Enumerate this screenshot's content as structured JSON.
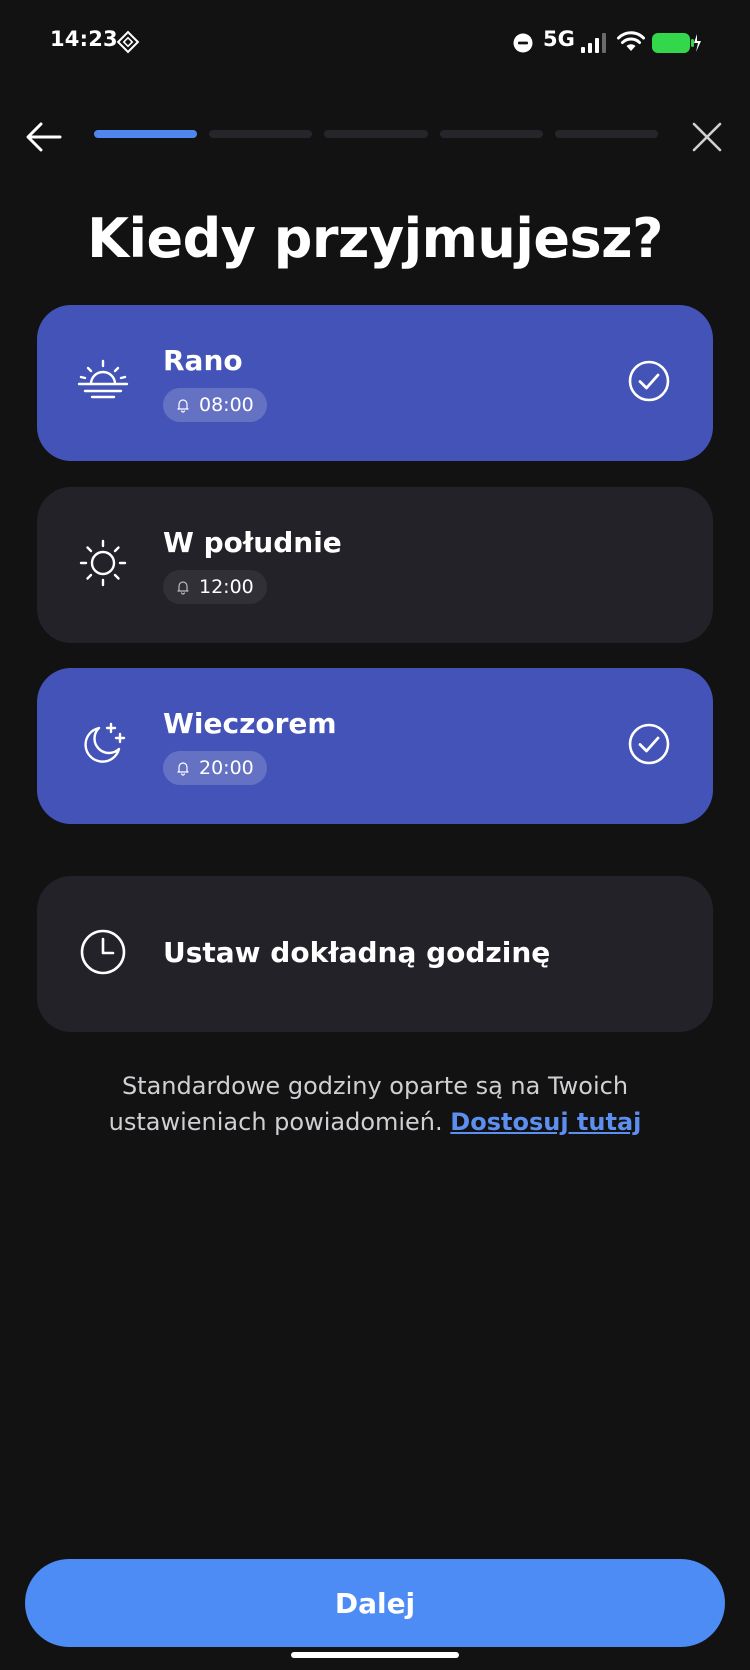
{
  "status_bar": {
    "time": "14:23",
    "network": "5G",
    "icons": [
      "app-notification-icon",
      "dnd-icon",
      "signal-icon",
      "wifi-icon",
      "battery-charging-icon"
    ],
    "battery_color": "#32d74b"
  },
  "nav": {
    "back_icon": "arrow-left-icon",
    "close_icon": "close-icon",
    "progress": {
      "total_steps": 5,
      "current_step": 1
    }
  },
  "title": "Kiedy przyjmujesz?",
  "options": [
    {
      "icon": "sunrise-icon",
      "label": "Rano",
      "time": "08:00",
      "selected": true
    },
    {
      "icon": "sun-icon",
      "label": "W południe",
      "time": "12:00",
      "selected": false
    },
    {
      "icon": "moon-stars-icon",
      "label": "Wieczorem",
      "time": "20:00",
      "selected": true
    }
  ],
  "custom_time": {
    "icon": "clock-icon",
    "label": "Ustaw dokładną godzinę"
  },
  "info": {
    "text": "Standardowe godziny oparte są na Twoich ustawieniach powiadomień.",
    "link": "Dostosuj tutaj"
  },
  "next_button": "Dalej",
  "colors": {
    "background": "#121212",
    "card": "#222228",
    "card_selected": "#4453b8",
    "accent": "#4d8cf5",
    "link": "#5c8ff0"
  }
}
